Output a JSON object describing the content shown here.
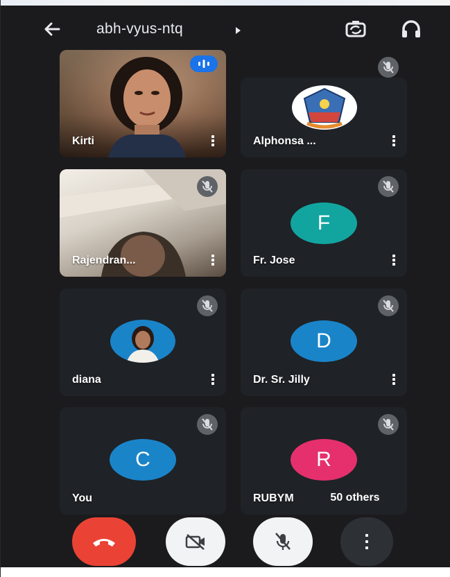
{
  "header": {
    "meeting_code": "abh-vyus-ntq"
  },
  "icons": {
    "back": "arrow-left-icon",
    "caret": "caret-right-icon",
    "switch_camera": "switch-camera-icon",
    "audio": "headphones-icon",
    "muted": "mic-off-icon",
    "menu": "more-vertical-icon",
    "end_call": "call-end-icon",
    "camera": "videocam-off-icon",
    "mic": "mic-off-icon",
    "more": "more-vertical-icon"
  },
  "participants": [
    {
      "name": "Kirti",
      "type": "video",
      "speaking": true
    },
    {
      "name": "Alphonsa ...",
      "type": "logo",
      "muted": true
    },
    {
      "name": "Rajendran...",
      "type": "video",
      "muted": true
    },
    {
      "name": "Fr. Jose",
      "type": "initial",
      "initial": "F",
      "color": "#12a5a0",
      "muted": true
    },
    {
      "name": "diana",
      "type": "photo",
      "muted": true
    },
    {
      "name": "Dr. Sr. Jilly",
      "type": "initial",
      "initial": "D",
      "color": "#1a84c9",
      "muted": true
    },
    {
      "name": "You",
      "type": "initial",
      "initial": "C",
      "color": "#1a84c9",
      "muted": true
    },
    {
      "name": "RUBYM",
      "type": "initial",
      "initial": "R",
      "color": "#e5306d",
      "muted": true
    }
  ],
  "others_label": "50 others",
  "colors": {
    "background": "#1b1b1e",
    "tile": "#202124",
    "end_call": "#ea4335",
    "speaking": "#1a73e8"
  }
}
